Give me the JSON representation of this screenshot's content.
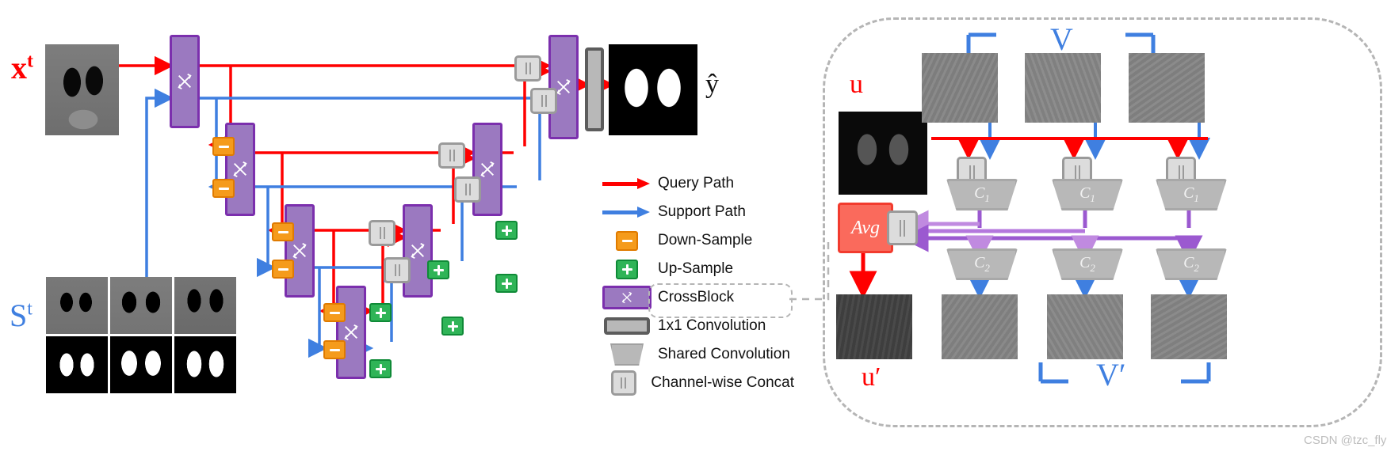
{
  "figure": {
    "title": "Cross-attention few-shot segmentation network diagram",
    "watermark": "CSDN @tzc_fly"
  },
  "colors": {
    "query_path": "#ff0000",
    "support_path": "#3f7fe0",
    "crossblock": "#9b79c0",
    "crossblock_border": "#7b2fad",
    "down_sample": "#f59b1c",
    "up_sample": "#2fb457",
    "concat": "#dcdcdc",
    "shared_conv": "#b8b8b8",
    "avg": "#fa6a5c",
    "purple_flow": "#9b59d0",
    "panel_dash": "#b5b5b5"
  },
  "left": {
    "query_input_label": "x",
    "query_input_sup": "t",
    "support_input_label": "S",
    "support_input_sup": "t",
    "output_label": "ŷ",
    "query_image_name": "query-ct-slice",
    "support_images": [
      {
        "name": "support-ct-1"
      },
      {
        "name": "support-ct-2"
      },
      {
        "name": "support-ct-3"
      },
      {
        "name": "support-mask-1"
      },
      {
        "name": "support-mask-2"
      },
      {
        "name": "support-mask-3"
      }
    ],
    "output_image_name": "predicted-lung-mask",
    "crossblocks": [
      {
        "name": "crossblock-enc-1"
      },
      {
        "name": "crossblock-enc-2"
      },
      {
        "name": "crossblock-enc-3"
      },
      {
        "name": "crossblock-bottleneck"
      },
      {
        "name": "crossblock-dec-3"
      },
      {
        "name": "crossblock-dec-2"
      },
      {
        "name": "crossblock-dec-1"
      }
    ]
  },
  "legend": {
    "items": [
      {
        "key": "arrow-red",
        "icon": "query-arrow-icon",
        "label": "Query Path"
      },
      {
        "key": "arrow-blue",
        "icon": "support-arrow-icon",
        "label": "Support Path"
      },
      {
        "key": "down-sample",
        "icon": "down-sample-icon",
        "label": "Down-Sample"
      },
      {
        "key": "up-sample",
        "icon": "up-sample-icon",
        "label": "Up-Sample"
      },
      {
        "key": "crossblock",
        "icon": "crossblock-icon",
        "label": "CrossBlock"
      },
      {
        "key": "conv11",
        "icon": "one-by-one-conv-icon",
        "label": "1x1 Convolution"
      },
      {
        "key": "shared-conv",
        "icon": "shared-conv-icon",
        "label": "Shared Convolution"
      },
      {
        "key": "concat",
        "icon": "channel-concat-icon",
        "label": "Channel-wise Concat"
      }
    ]
  },
  "right": {
    "query_feature_label": "u",
    "support_feature_label": "V",
    "query_output_label": "u′",
    "support_output_label": "V′",
    "avg_label": "Avg",
    "conv_stage_1": "C",
    "conv_stage_1_sub": "1",
    "conv_stage_2": "C",
    "conv_stage_2_sub": "2",
    "branches": [
      {
        "name": "branch-1",
        "conv1": "C1",
        "conv2": "C2"
      },
      {
        "name": "branch-2",
        "conv1": "C1",
        "conv2": "C2"
      },
      {
        "name": "branch-3",
        "conv1": "C1",
        "conv2": "C2"
      }
    ],
    "top_feature_maps": [
      "support-feature-1",
      "support-feature-2",
      "support-feature-3"
    ],
    "bottom_feature_maps": [
      "support-out-1",
      "support-out-2",
      "support-out-3"
    ],
    "query_feature_image": "query-feature-map",
    "query_output_image": "query-output-map"
  }
}
